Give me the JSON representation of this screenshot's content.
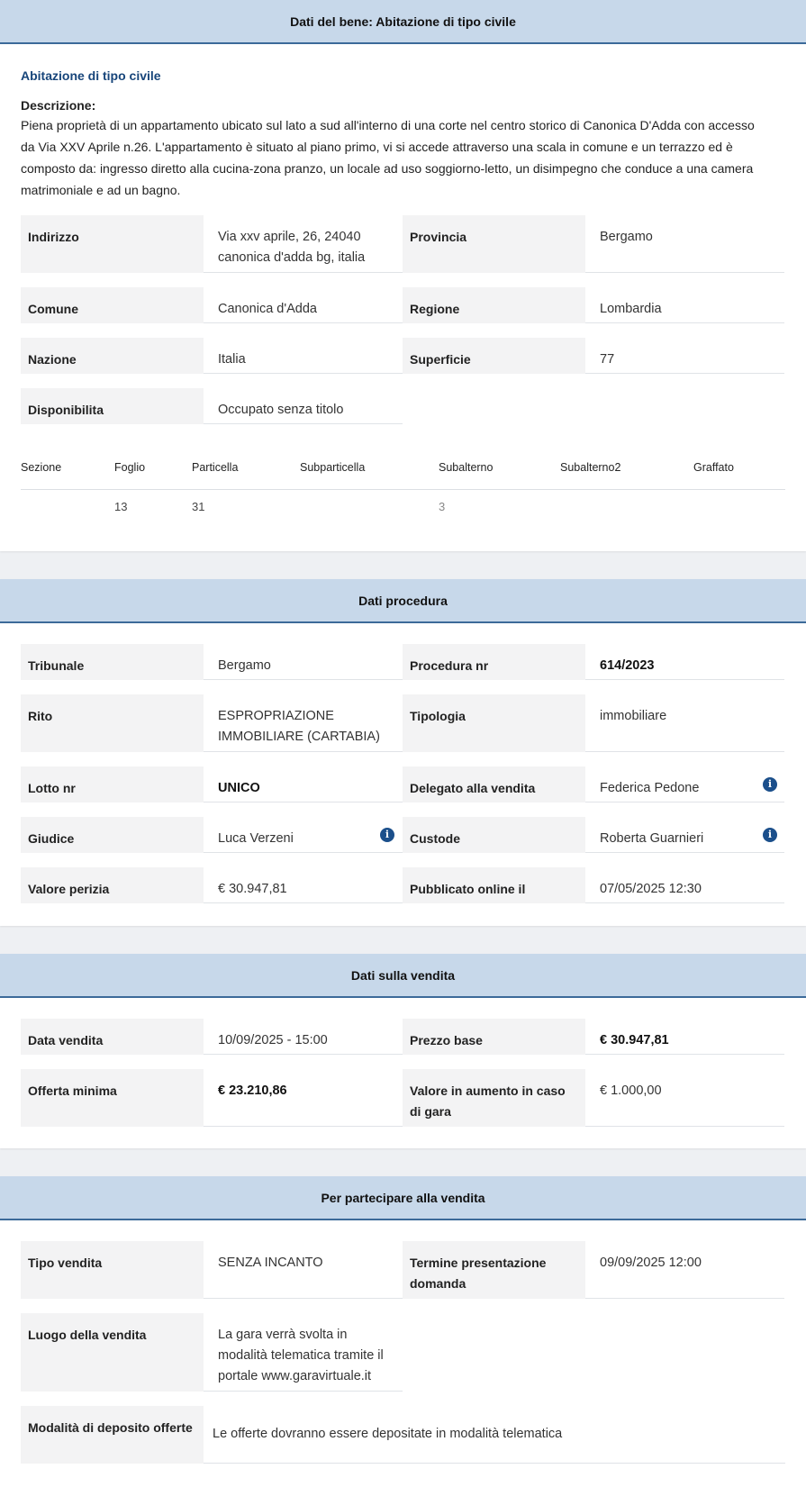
{
  "bene": {
    "header": "Dati del bene: Abitazione di tipo civile",
    "subtitle": "Abitazione di tipo civile",
    "desc_label": "Descrizione:",
    "desc_text": "Piena proprietà di un appartamento ubicato sul lato a sud all'interno di una corte nel centro storico di Canonica D'Adda con accesso da Via XXV Aprile n.26. L'appartamento è situato al piano primo, vi si accede attraverso una scala in comune e un terrazzo ed è composto da: ingresso diretto alla cucina-zona pranzo, un locale ad uso soggiorno-letto, un disimpegno che conduce a una camera matrimoniale e ad un bagno.",
    "indirizzo_k": "Indirizzo",
    "indirizzo_v": "Via xxv aprile, 26, 24040 canonica d'adda bg, italia",
    "provincia_k": "Provincia",
    "provincia_v": "Bergamo",
    "comune_k": "Comune",
    "comune_v": "Canonica d'Adda",
    "regione_k": "Regione",
    "regione_v": "Lombardia",
    "nazione_k": "Nazione",
    "nazione_v": "Italia",
    "superficie_k": "Superficie",
    "superficie_v": "77",
    "disponibilita_k": "Disponibilita",
    "disponibilita_v": "Occupato senza titolo",
    "catasto": {
      "headers": [
        "Sezione",
        "Foglio",
        "Particella",
        "Subparticella",
        "Subalterno",
        "Subalterno2",
        "Graffato"
      ],
      "values": [
        "",
        "13",
        "31",
        "",
        "3",
        "",
        ""
      ]
    }
  },
  "procedura": {
    "header": "Dati procedura",
    "tribunale_k": "Tribunale",
    "tribunale_v": "Bergamo",
    "proc_k": "Procedura nr",
    "proc_v": "614/2023",
    "rito_k": "Rito",
    "rito_v": "ESPROPRIAZIONE IMMOBILIARE (CARTABIA)",
    "tipologia_k": "Tipologia",
    "tipologia_v": "immobiliare",
    "lotto_k": "Lotto nr",
    "lotto_v": "UNICO",
    "delegato_k": "Delegato alla vendita",
    "delegato_v": "Federica Pedone",
    "giudice_k": "Giudice",
    "giudice_v": "Luca Verzeni",
    "custode_k": "Custode",
    "custode_v": "Roberta Guarnieri",
    "perizia_k": "Valore perizia",
    "perizia_v": "€ 30.947,81",
    "pubblicato_k": "Pubblicato online il",
    "pubblicato_v": "07/05/2025 12:30"
  },
  "vendita": {
    "header": "Dati sulla vendita",
    "data_k": "Data vendita",
    "data_v": "10/09/2025 - 15:00",
    "prezzo_k": "Prezzo base",
    "prezzo_v": "€ 30.947,81",
    "offerta_k": "Offerta minima",
    "offerta_v": "€ 23.210,86",
    "aumento_k": "Valore in aumento in caso di gara",
    "aumento_v": "€ 1.000,00"
  },
  "partecipare": {
    "header": "Per partecipare alla vendita",
    "tipo_k": "Tipo vendita",
    "tipo_v": "SENZA INCANTO",
    "termine_k": "Termine presentazione domanda",
    "termine_v": "09/09/2025 12:00",
    "luogo_k": "Luogo della vendita",
    "luogo_v": "La gara verrà svolta in modalità telematica tramite il portale www.garavirtuale.it",
    "deposito_k": "Modalità di deposito offerte",
    "deposito_v": "Le offerte dovranno essere depositate in modalità telematica"
  },
  "icons": {
    "info": "info-icon",
    "info_glyph": "i"
  },
  "colors": {
    "header_bg": "#c7d8ea",
    "header_border": "#3c6a99",
    "title_blue": "#17457a",
    "icon_blue": "#1b4f8b"
  }
}
